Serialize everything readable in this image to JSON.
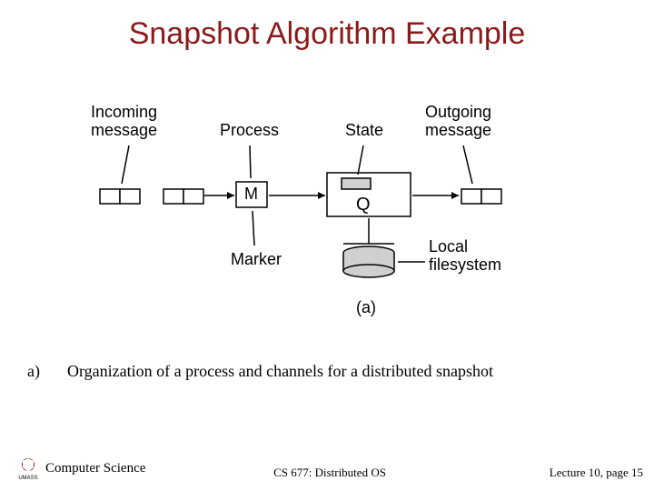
{
  "title": "Snapshot Algorithm Example",
  "diagram": {
    "labels": {
      "incoming": "Incoming\nmessage",
      "process": "Process",
      "state": "State",
      "outgoing": "Outgoing\nmessage",
      "marker": "Marker",
      "localfs": "Local\nfilesystem"
    },
    "nodes": {
      "m": "M",
      "q": "Q"
    },
    "subfig": "(a)"
  },
  "caption": {
    "letter": "a)",
    "text": "Organization of a process and channels for a distributed snapshot"
  },
  "footer": {
    "dept": "Computer Science",
    "course": "CS 677: Distributed OS",
    "pageinfo": "Lecture 10, page 15"
  }
}
